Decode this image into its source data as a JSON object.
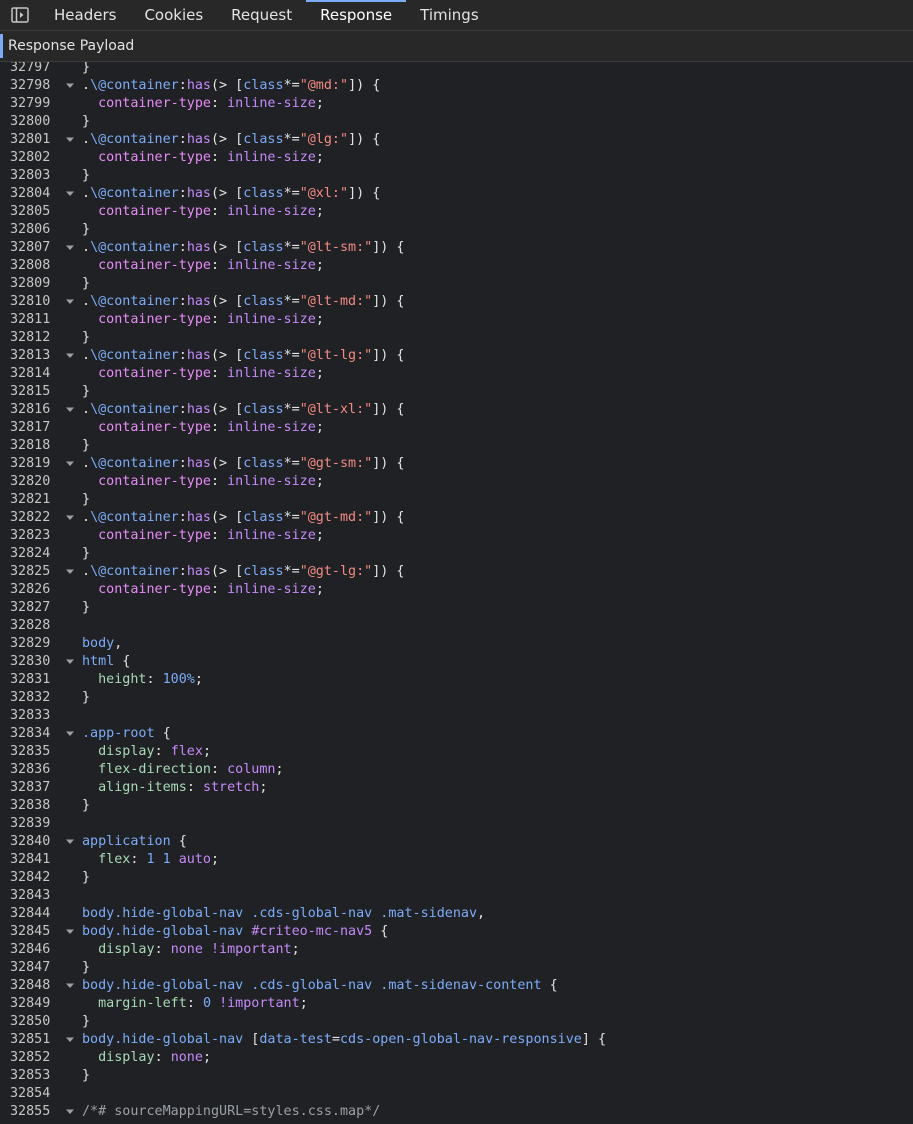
{
  "tabs": [
    {
      "label": "Headers"
    },
    {
      "label": "Cookies"
    },
    {
      "label": "Request"
    },
    {
      "label": "Response"
    },
    {
      "label": "Timings"
    }
  ],
  "active_tab": "Response",
  "subheader": {
    "title": "Response Payload"
  },
  "colors": {
    "background": "#202124",
    "tab_accent": "#7cacf8",
    "line_number": "#c4c7c5",
    "selector": "#7cacf8",
    "property": "#e78bf7",
    "string": "#f28b82",
    "value": "#c58af9",
    "number": "#7cacf8"
  },
  "lines": [
    {
      "n": "32797",
      "fold": false,
      "tokens": [
        [
          "t",
          "}"
        ]
      ]
    },
    {
      "n": "32798",
      "fold": true,
      "tokens": [
        [
          "t",
          "."
        ],
        [
          "s",
          "\\@container"
        ],
        [
          "t",
          ":"
        ],
        [
          "a",
          "has"
        ],
        [
          "t",
          "(> ["
        ],
        [
          "s",
          "class"
        ],
        [
          "t",
          "*="
        ],
        [
          "r",
          "\"@md:\""
        ],
        [
          "t",
          "]) {"
        ]
      ]
    },
    {
      "n": "32799",
      "fold": false,
      "tokens": [
        [
          "t",
          "  "
        ],
        [
          "p",
          "container-type"
        ],
        [
          "t",
          ": "
        ],
        [
          "v",
          "inline-size"
        ],
        [
          "t",
          ";"
        ]
      ]
    },
    {
      "n": "32800",
      "fold": false,
      "tokens": [
        [
          "t",
          "}"
        ]
      ]
    },
    {
      "n": "32801",
      "fold": true,
      "tokens": [
        [
          "t",
          "."
        ],
        [
          "s",
          "\\@container"
        ],
        [
          "t",
          ":"
        ],
        [
          "a",
          "has"
        ],
        [
          "t",
          "(> ["
        ],
        [
          "s",
          "class"
        ],
        [
          "t",
          "*="
        ],
        [
          "r",
          "\"@lg:\""
        ],
        [
          "t",
          "]) {"
        ]
      ]
    },
    {
      "n": "32802",
      "fold": false,
      "tokens": [
        [
          "t",
          "  "
        ],
        [
          "p",
          "container-type"
        ],
        [
          "t",
          ": "
        ],
        [
          "v",
          "inline-size"
        ],
        [
          "t",
          ";"
        ]
      ]
    },
    {
      "n": "32803",
      "fold": false,
      "tokens": [
        [
          "t",
          "}"
        ]
      ]
    },
    {
      "n": "32804",
      "fold": true,
      "tokens": [
        [
          "t",
          "."
        ],
        [
          "s",
          "\\@container"
        ],
        [
          "t",
          ":"
        ],
        [
          "a",
          "has"
        ],
        [
          "t",
          "(> ["
        ],
        [
          "s",
          "class"
        ],
        [
          "t",
          "*="
        ],
        [
          "r",
          "\"@xl:\""
        ],
        [
          "t",
          "]) {"
        ]
      ]
    },
    {
      "n": "32805",
      "fold": false,
      "tokens": [
        [
          "t",
          "  "
        ],
        [
          "p",
          "container-type"
        ],
        [
          "t",
          ": "
        ],
        [
          "v",
          "inline-size"
        ],
        [
          "t",
          ";"
        ]
      ]
    },
    {
      "n": "32806",
      "fold": false,
      "tokens": [
        [
          "t",
          "}"
        ]
      ]
    },
    {
      "n": "32807",
      "fold": true,
      "tokens": [
        [
          "t",
          "."
        ],
        [
          "s",
          "\\@container"
        ],
        [
          "t",
          ":"
        ],
        [
          "a",
          "has"
        ],
        [
          "t",
          "(> ["
        ],
        [
          "s",
          "class"
        ],
        [
          "t",
          "*="
        ],
        [
          "r",
          "\"@lt-sm:\""
        ],
        [
          "t",
          "]) {"
        ]
      ]
    },
    {
      "n": "32808",
      "fold": false,
      "tokens": [
        [
          "t",
          "  "
        ],
        [
          "p",
          "container-type"
        ],
        [
          "t",
          ": "
        ],
        [
          "v",
          "inline-size"
        ],
        [
          "t",
          ";"
        ]
      ]
    },
    {
      "n": "32809",
      "fold": false,
      "tokens": [
        [
          "t",
          "}"
        ]
      ]
    },
    {
      "n": "32810",
      "fold": true,
      "tokens": [
        [
          "t",
          "."
        ],
        [
          "s",
          "\\@container"
        ],
        [
          "t",
          ":"
        ],
        [
          "a",
          "has"
        ],
        [
          "t",
          "(> ["
        ],
        [
          "s",
          "class"
        ],
        [
          "t",
          "*="
        ],
        [
          "r",
          "\"@lt-md:\""
        ],
        [
          "t",
          "]) {"
        ]
      ]
    },
    {
      "n": "32811",
      "fold": false,
      "tokens": [
        [
          "t",
          "  "
        ],
        [
          "p",
          "container-type"
        ],
        [
          "t",
          ": "
        ],
        [
          "v",
          "inline-size"
        ],
        [
          "t",
          ";"
        ]
      ]
    },
    {
      "n": "32812",
      "fold": false,
      "tokens": [
        [
          "t",
          "}"
        ]
      ]
    },
    {
      "n": "32813",
      "fold": true,
      "tokens": [
        [
          "t",
          "."
        ],
        [
          "s",
          "\\@container"
        ],
        [
          "t",
          ":"
        ],
        [
          "a",
          "has"
        ],
        [
          "t",
          "(> ["
        ],
        [
          "s",
          "class"
        ],
        [
          "t",
          "*="
        ],
        [
          "r",
          "\"@lt-lg:\""
        ],
        [
          "t",
          "]) {"
        ]
      ]
    },
    {
      "n": "32814",
      "fold": false,
      "tokens": [
        [
          "t",
          "  "
        ],
        [
          "p",
          "container-type"
        ],
        [
          "t",
          ": "
        ],
        [
          "v",
          "inline-size"
        ],
        [
          "t",
          ";"
        ]
      ]
    },
    {
      "n": "32815",
      "fold": false,
      "tokens": [
        [
          "t",
          "}"
        ]
      ]
    },
    {
      "n": "32816",
      "fold": true,
      "tokens": [
        [
          "t",
          "."
        ],
        [
          "s",
          "\\@container"
        ],
        [
          "t",
          ":"
        ],
        [
          "a",
          "has"
        ],
        [
          "t",
          "(> ["
        ],
        [
          "s",
          "class"
        ],
        [
          "t",
          "*="
        ],
        [
          "r",
          "\"@lt-xl:\""
        ],
        [
          "t",
          "]) {"
        ]
      ]
    },
    {
      "n": "32817",
      "fold": false,
      "tokens": [
        [
          "t",
          "  "
        ],
        [
          "p",
          "container-type"
        ],
        [
          "t",
          ": "
        ],
        [
          "v",
          "inline-size"
        ],
        [
          "t",
          ";"
        ]
      ]
    },
    {
      "n": "32818",
      "fold": false,
      "tokens": [
        [
          "t",
          "}"
        ]
      ]
    },
    {
      "n": "32819",
      "fold": true,
      "tokens": [
        [
          "t",
          "."
        ],
        [
          "s",
          "\\@container"
        ],
        [
          "t",
          ":"
        ],
        [
          "a",
          "has"
        ],
        [
          "t",
          "(> ["
        ],
        [
          "s",
          "class"
        ],
        [
          "t",
          "*="
        ],
        [
          "r",
          "\"@gt-sm:\""
        ],
        [
          "t",
          "]) {"
        ]
      ]
    },
    {
      "n": "32820",
      "fold": false,
      "tokens": [
        [
          "t",
          "  "
        ],
        [
          "p",
          "container-type"
        ],
        [
          "t",
          ": "
        ],
        [
          "v",
          "inline-size"
        ],
        [
          "t",
          ";"
        ]
      ]
    },
    {
      "n": "32821",
      "fold": false,
      "tokens": [
        [
          "t",
          "}"
        ]
      ]
    },
    {
      "n": "32822",
      "fold": true,
      "tokens": [
        [
          "t",
          "."
        ],
        [
          "s",
          "\\@container"
        ],
        [
          "t",
          ":"
        ],
        [
          "a",
          "has"
        ],
        [
          "t",
          "(> ["
        ],
        [
          "s",
          "class"
        ],
        [
          "t",
          "*="
        ],
        [
          "r",
          "\"@gt-md:\""
        ],
        [
          "t",
          "]) {"
        ]
      ]
    },
    {
      "n": "32823",
      "fold": false,
      "tokens": [
        [
          "t",
          "  "
        ],
        [
          "p",
          "container-type"
        ],
        [
          "t",
          ": "
        ],
        [
          "v",
          "inline-size"
        ],
        [
          "t",
          ";"
        ]
      ]
    },
    {
      "n": "32824",
      "fold": false,
      "tokens": [
        [
          "t",
          "}"
        ]
      ]
    },
    {
      "n": "32825",
      "fold": true,
      "tokens": [
        [
          "t",
          "."
        ],
        [
          "s",
          "\\@container"
        ],
        [
          "t",
          ":"
        ],
        [
          "a",
          "has"
        ],
        [
          "t",
          "(> ["
        ],
        [
          "s",
          "class"
        ],
        [
          "t",
          "*="
        ],
        [
          "r",
          "\"@gt-lg:\""
        ],
        [
          "t",
          "]) {"
        ]
      ]
    },
    {
      "n": "32826",
      "fold": false,
      "tokens": [
        [
          "t",
          "  "
        ],
        [
          "p",
          "container-type"
        ],
        [
          "t",
          ": "
        ],
        [
          "v",
          "inline-size"
        ],
        [
          "t",
          ";"
        ]
      ]
    },
    {
      "n": "32827",
      "fold": false,
      "tokens": [
        [
          "t",
          "}"
        ]
      ]
    },
    {
      "n": "32828",
      "fold": false,
      "tokens": []
    },
    {
      "n": "32829",
      "fold": false,
      "tokens": [
        [
          "s",
          "body"
        ],
        [
          "t",
          ","
        ]
      ]
    },
    {
      "n": "32830",
      "fold": true,
      "tokens": [
        [
          "s",
          "html"
        ],
        [
          "t",
          " {"
        ]
      ]
    },
    {
      "n": "32831",
      "fold": false,
      "tokens": [
        [
          "t",
          "  "
        ],
        [
          "g",
          "height"
        ],
        [
          "t",
          ": "
        ],
        [
          "n",
          "100%"
        ],
        [
          "t",
          ";"
        ]
      ]
    },
    {
      "n": "32832",
      "fold": false,
      "tokens": [
        [
          "t",
          "}"
        ]
      ]
    },
    {
      "n": "32833",
      "fold": false,
      "tokens": []
    },
    {
      "n": "32834",
      "fold": true,
      "tokens": [
        [
          "s",
          ".app-root"
        ],
        [
          "t",
          " {"
        ]
      ]
    },
    {
      "n": "32835",
      "fold": false,
      "tokens": [
        [
          "t",
          "  "
        ],
        [
          "g",
          "display"
        ],
        [
          "t",
          ": "
        ],
        [
          "k",
          "flex"
        ],
        [
          "t",
          ";"
        ]
      ]
    },
    {
      "n": "32836",
      "fold": false,
      "tokens": [
        [
          "t",
          "  "
        ],
        [
          "g",
          "flex-direction"
        ],
        [
          "t",
          ": "
        ],
        [
          "k",
          "column"
        ],
        [
          "t",
          ";"
        ]
      ]
    },
    {
      "n": "32837",
      "fold": false,
      "tokens": [
        [
          "t",
          "  "
        ],
        [
          "g",
          "align-items"
        ],
        [
          "t",
          ": "
        ],
        [
          "k",
          "stretch"
        ],
        [
          "t",
          ";"
        ]
      ]
    },
    {
      "n": "32838",
      "fold": false,
      "tokens": [
        [
          "t",
          "}"
        ]
      ]
    },
    {
      "n": "32839",
      "fold": false,
      "tokens": []
    },
    {
      "n": "32840",
      "fold": true,
      "tokens": [
        [
          "s",
          "application"
        ],
        [
          "t",
          " {"
        ]
      ]
    },
    {
      "n": "32841",
      "fold": false,
      "tokens": [
        [
          "t",
          "  "
        ],
        [
          "g",
          "flex"
        ],
        [
          "t",
          ": "
        ],
        [
          "n",
          "1"
        ],
        [
          "t",
          " "
        ],
        [
          "n",
          "1"
        ],
        [
          "t",
          " "
        ],
        [
          "k",
          "auto"
        ],
        [
          "t",
          ";"
        ]
      ]
    },
    {
      "n": "32842",
      "fold": false,
      "tokens": [
        [
          "t",
          "}"
        ]
      ]
    },
    {
      "n": "32843",
      "fold": false,
      "tokens": []
    },
    {
      "n": "32844",
      "fold": false,
      "tokens": [
        [
          "s",
          "body.hide-global-nav .cds-global-nav .mat-sidenav"
        ],
        [
          "t",
          ","
        ]
      ]
    },
    {
      "n": "32845",
      "fold": true,
      "tokens": [
        [
          "s",
          "body.hide-global-nav "
        ],
        [
          "k",
          "#criteo-mc-nav5"
        ],
        [
          "t",
          " {"
        ]
      ]
    },
    {
      "n": "32846",
      "fold": false,
      "tokens": [
        [
          "t",
          "  "
        ],
        [
          "g",
          "display"
        ],
        [
          "t",
          ": "
        ],
        [
          "k",
          "none !important"
        ],
        [
          "t",
          ";"
        ]
      ]
    },
    {
      "n": "32847",
      "fold": false,
      "tokens": [
        [
          "t",
          "}"
        ]
      ]
    },
    {
      "n": "32848",
      "fold": true,
      "tokens": [
        [
          "s",
          "body.hide-global-nav .cds-global-nav .mat-sidenav-content"
        ],
        [
          "t",
          " {"
        ]
      ]
    },
    {
      "n": "32849",
      "fold": false,
      "tokens": [
        [
          "t",
          "  "
        ],
        [
          "g",
          "margin-left"
        ],
        [
          "t",
          ": "
        ],
        [
          "n",
          "0"
        ],
        [
          "t",
          " "
        ],
        [
          "k",
          "!important"
        ],
        [
          "t",
          ";"
        ]
      ]
    },
    {
      "n": "32850",
      "fold": false,
      "tokens": [
        [
          "t",
          "}"
        ]
      ]
    },
    {
      "n": "32851",
      "fold": true,
      "tokens": [
        [
          "s",
          "body.hide-global-nav"
        ],
        [
          "t",
          " ["
        ],
        [
          "s",
          "data-test"
        ],
        [
          "t",
          "="
        ],
        [
          "s",
          "cds-open-global-nav-responsive"
        ],
        [
          "t",
          "] {"
        ]
      ]
    },
    {
      "n": "32852",
      "fold": false,
      "tokens": [
        [
          "t",
          "  "
        ],
        [
          "g",
          "display"
        ],
        [
          "t",
          ": "
        ],
        [
          "k",
          "none"
        ],
        [
          "t",
          ";"
        ]
      ]
    },
    {
      "n": "32853",
      "fold": false,
      "tokens": [
        [
          "t",
          "}"
        ]
      ]
    },
    {
      "n": "32854",
      "fold": false,
      "tokens": []
    },
    {
      "n": "32855",
      "fold": true,
      "tokens": [
        [
          "c",
          "/*# sourceMappingURL=styles.css.map*/"
        ]
      ]
    }
  ]
}
